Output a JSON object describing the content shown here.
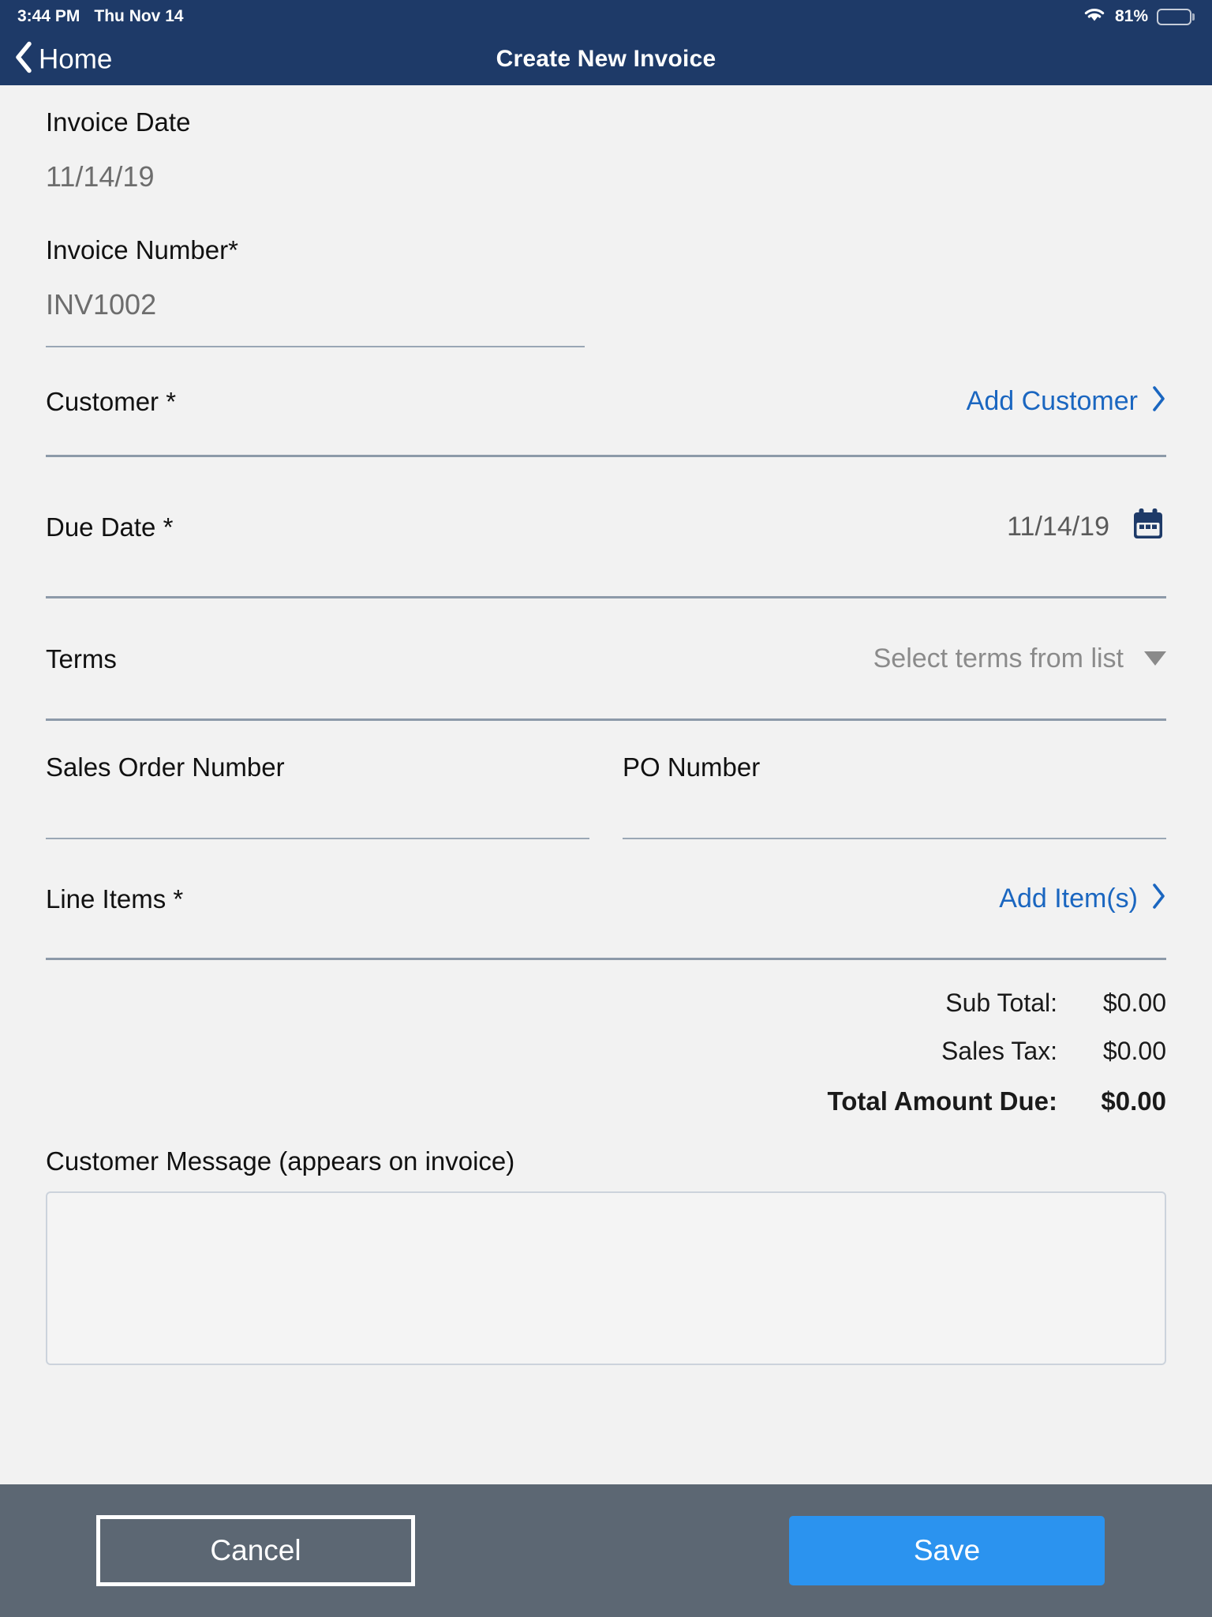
{
  "status_bar": {
    "time": "3:44 PM",
    "date": "Thu Nov 14",
    "wifi_icon": "wifi-icon",
    "battery_percent": "81%",
    "battery_icon": "battery-icon"
  },
  "nav_bar": {
    "back_icon": "chevron-left-icon",
    "back_label": "Home",
    "title": "Create New Invoice",
    "background_color": "#1e3a68"
  },
  "form": {
    "invoice_date": {
      "label": "Invoice Date",
      "value": "11/14/19"
    },
    "invoice_number": {
      "label": "Invoice Number*",
      "value": "INV1002"
    },
    "customer": {
      "label": "Customer *",
      "action_label": "Add Customer",
      "action_icon": "chevron-right-icon"
    },
    "due_date": {
      "label": "Due Date *",
      "value": "11/14/19",
      "icon": "calendar-icon"
    },
    "terms": {
      "label": "Terms",
      "placeholder": "Select terms from list",
      "icon": "chevron-down-icon"
    },
    "sales_order_number": {
      "label": "Sales Order Number",
      "value": ""
    },
    "po_number": {
      "label": "PO Number",
      "value": ""
    },
    "line_items": {
      "label": "Line Items *",
      "action_label": "Add Item(s)",
      "action_icon": "chevron-right-icon"
    },
    "totals": [
      {
        "label": "Sub Total:",
        "amount": "$0.00"
      },
      {
        "label": "Sales Tax:",
        "amount": "$0.00"
      },
      {
        "label": "Total Amount Due:",
        "amount": "$0.00"
      }
    ],
    "customer_message": {
      "label": "Customer Message (appears on invoice)",
      "value": "",
      "placeholder": ""
    }
  },
  "bottom_bar": {
    "cancel_label": "Cancel",
    "save_label": "Save",
    "background_color": "#5c6773",
    "save_color": "#2b93ef"
  },
  "colors": {
    "link_blue": "#1a66c0",
    "page_background": "#f2f2f2",
    "divider": "#8d9aa9"
  }
}
